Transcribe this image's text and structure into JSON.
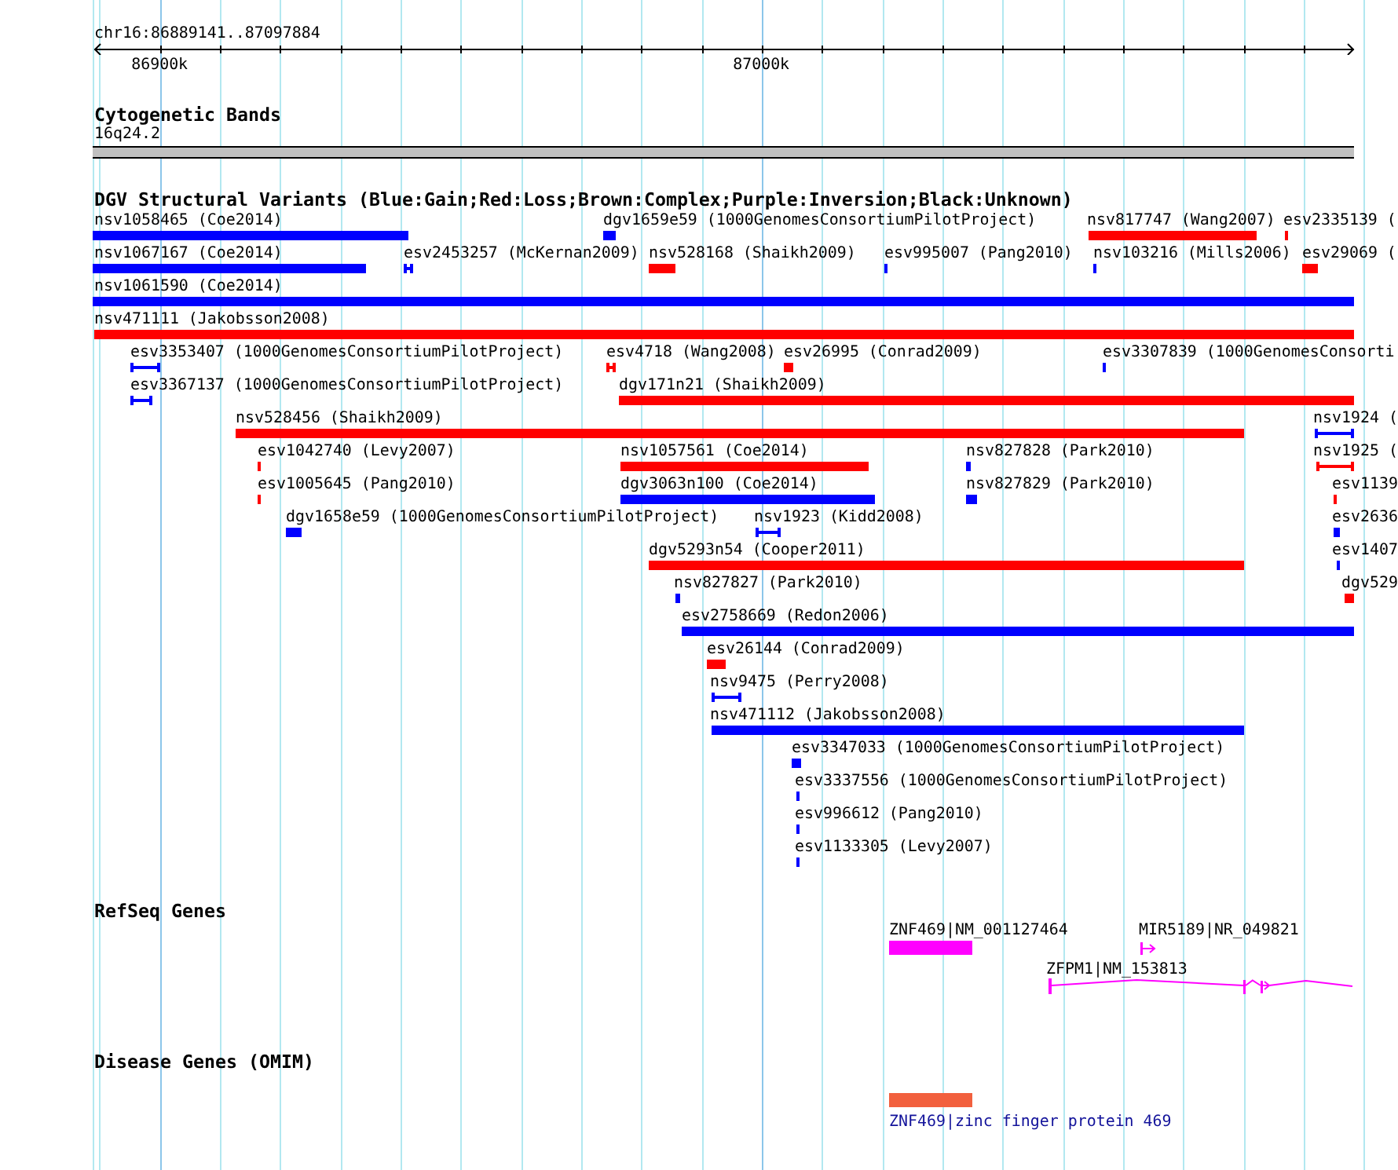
{
  "ruler": {
    "location": "chr16:86889141..87097884",
    "ticks": [
      "86900k",
      "87000k"
    ]
  },
  "tracks": [
    {
      "kind": "cytoband",
      "title": "Cytogenetic Bands",
      "band": "16q24.2"
    },
    {
      "kind": "variants",
      "title": "DGV Structural Variants (Blue:Gain;Red:Loss;Brown:Complex;Purple:Inversion;Black:Unknown)",
      "features": [
        {
          "label": "nsv1058465 (Coe2014)",
          "kind": "bar",
          "color": "#0000ff"
        },
        {
          "label": "dgv1659e59 (1000GenomesConsortiumPilotProject)",
          "kind": "bar",
          "color": "#0000ff"
        },
        {
          "label": "nsv817747 (Wang2007)",
          "kind": "bar",
          "color": "#ff0000"
        },
        {
          "label": "esv2335139 (",
          "kind": "bar",
          "color": "#ff0000"
        },
        {
          "label": "nsv1067167 (Coe2014)",
          "kind": "bar",
          "color": "#0000ff"
        },
        {
          "label": "esv2453257 (McKernan2009)",
          "kind": "span",
          "color": "#0000ff"
        },
        {
          "label": "nsv528168 (Shaikh2009)",
          "kind": "bar",
          "color": "#ff0000"
        },
        {
          "label": "esv995007 (Pang2010)",
          "kind": "bar",
          "color": "#0000ff"
        },
        {
          "label": "nsv103216 (Mills2006)",
          "kind": "bar",
          "color": "#0000ff"
        },
        {
          "label": "esv29069 (",
          "kind": "bar",
          "color": "#ff0000"
        },
        {
          "label": "nsv1061590 (Coe2014)",
          "kind": "bar",
          "color": "#0000ff"
        },
        {
          "label": "nsv471111 (Jakobsson2008)",
          "kind": "bar",
          "color": "#ff0000"
        },
        {
          "label": "esv3353407 (1000GenomesConsortiumPilotProject)",
          "kind": "span",
          "color": "#0000ff"
        },
        {
          "label": "esv4718 (Wang2008)",
          "kind": "span",
          "color": "#ff0000"
        },
        {
          "label": "esv26995 (Conrad2009)",
          "kind": "bar",
          "color": "#ff0000"
        },
        {
          "label": "esv3307839 (1000GenomesConsorti",
          "kind": "bar",
          "color": "#0000ff"
        },
        {
          "label": "esv3367137 (1000GenomesConsortiumPilotProject)",
          "kind": "span",
          "color": "#0000ff"
        },
        {
          "label": "dgv171n21 (Shaikh2009)",
          "kind": "bar",
          "color": "#ff0000"
        },
        {
          "label": "nsv528456 (Shaikh2009)",
          "kind": "bar",
          "color": "#ff0000"
        },
        {
          "label": "nsv1924 (",
          "kind": "span",
          "color": "#0000ff"
        },
        {
          "label": "esv1042740 (Levy2007)",
          "kind": "bar",
          "color": "#ff0000"
        },
        {
          "label": "nsv1057561 (Coe2014)",
          "kind": "bar",
          "color": "#ff0000"
        },
        {
          "label": "nsv827828 (Park2010)",
          "kind": "bar",
          "color": "#0000ff"
        },
        {
          "label": "nsv1925 (",
          "kind": "span",
          "color": "#ff0000"
        },
        {
          "label": "esv1005645 (Pang2010)",
          "kind": "bar",
          "color": "#ff0000"
        },
        {
          "label": "dgv3063n100 (Coe2014)",
          "kind": "bar",
          "color": "#0000ff"
        },
        {
          "label": "nsv827829 (Park2010)",
          "kind": "bar",
          "color": "#0000ff"
        },
        {
          "label": "esv1139",
          "kind": "bar",
          "color": "#ff0000"
        },
        {
          "label": "dgv1658e59 (1000GenomesConsortiumPilotProject)",
          "kind": "bar",
          "color": "#0000ff"
        },
        {
          "label": "nsv1923 (Kidd2008)",
          "kind": "span",
          "color": "#0000ff"
        },
        {
          "label": "esv2636",
          "kind": "bar",
          "color": "#0000ff"
        },
        {
          "label": "dgv5293n54 (Cooper2011)",
          "kind": "bar",
          "color": "#ff0000"
        },
        {
          "label": "esv1407",
          "kind": "bar",
          "color": "#0000ff"
        },
        {
          "label": "nsv827827 (Park2010)",
          "kind": "bar",
          "color": "#0000ff"
        },
        {
          "label": "dgv529",
          "kind": "bar",
          "color": "#ff0000"
        },
        {
          "label": "esv2758669 (Redon2006)",
          "kind": "bar",
          "color": "#0000ff"
        },
        {
          "label": "esv26144 (Conrad2009)",
          "kind": "bar",
          "color": "#ff0000"
        },
        {
          "label": "nsv9475 (Perry2008)",
          "kind": "span",
          "color": "#0000ff"
        },
        {
          "label": "nsv471112 (Jakobsson2008)",
          "kind": "bar",
          "color": "#0000ff"
        },
        {
          "label": "esv3347033 (1000GenomesConsortiumPilotProject)",
          "kind": "bar",
          "color": "#0000ff"
        },
        {
          "label": "esv3337556 (1000GenomesConsortiumPilotProject)",
          "kind": "bar",
          "color": "#0000ff"
        },
        {
          "label": "esv996612 (Pang2010)",
          "kind": "bar",
          "color": "#0000ff"
        },
        {
          "label": "esv1133305 (Levy2007)",
          "kind": "bar",
          "color": "#0000ff"
        }
      ]
    },
    {
      "kind": "genes",
      "title": "RefSeq Genes",
      "features": [
        {
          "label": "ZNF469|NM_001127464",
          "kind": "block"
        },
        {
          "label": "MIR5189|NR_049821",
          "kind": "arrow"
        },
        {
          "label": "ZFPM1|NM_153813",
          "kind": "model"
        }
      ]
    },
    {
      "kind": "disease",
      "title": "Disease Genes (OMIM)",
      "features": [
        {
          "label": "ZNF469|zinc finger protein 469",
          "kind": "block"
        }
      ]
    }
  ]
}
